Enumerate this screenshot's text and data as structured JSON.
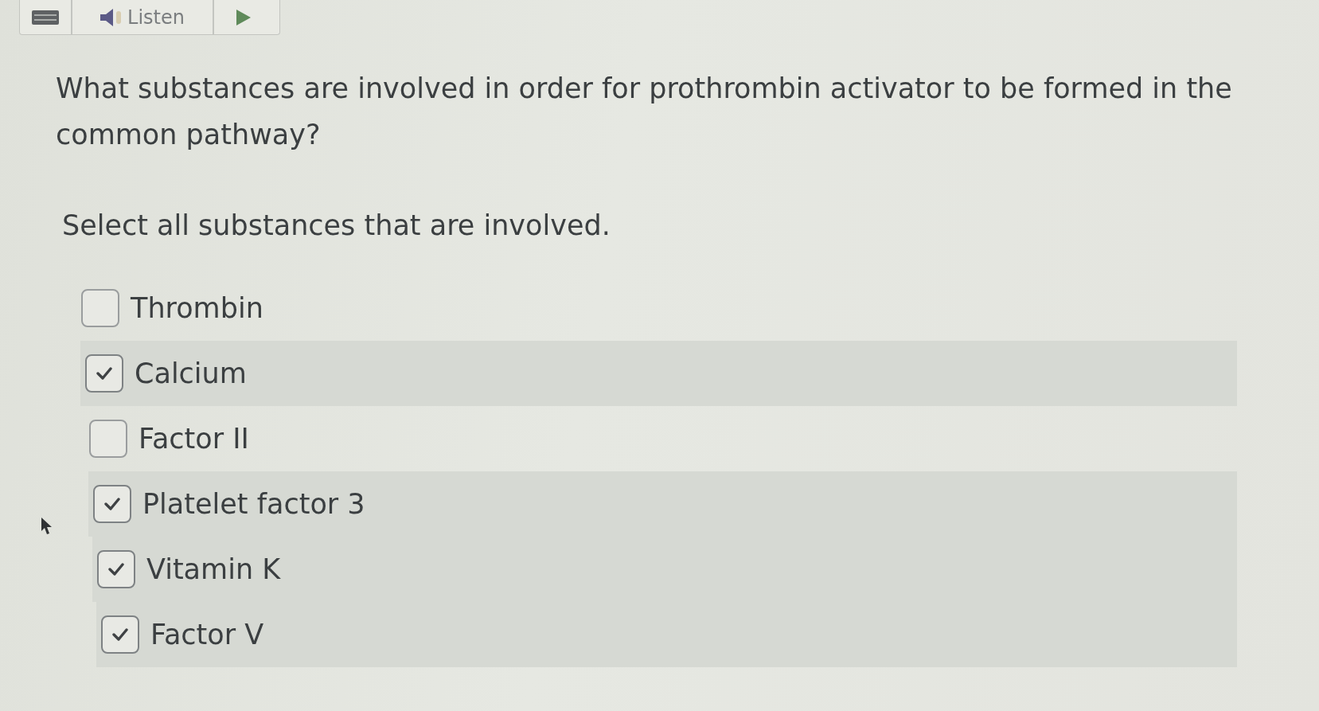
{
  "toolbar": {
    "buttons": [
      {
        "kind": "menu"
      },
      {
        "kind": "listen",
        "label": "Listen"
      },
      {
        "kind": "play"
      }
    ]
  },
  "question": {
    "prompt": "What substances are involved in order for prothrombin activator to be formed in the common pathway?",
    "instruction": "Select all substances that are involved."
  },
  "options": [
    {
      "label": "Thrombin",
      "checked": false
    },
    {
      "label": "Calcium",
      "checked": true
    },
    {
      "label": "Factor II",
      "checked": false
    },
    {
      "label": "Platelet factor 3",
      "checked": true
    },
    {
      "label": "Vitamin K",
      "checked": true
    },
    {
      "label": "Factor V",
      "checked": true
    }
  ]
}
